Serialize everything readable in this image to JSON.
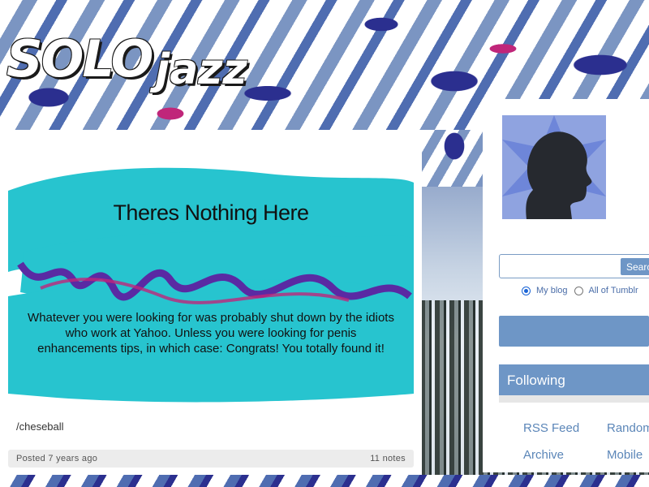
{
  "logo": {
    "part1": "SOLO",
    "part2": "jazz"
  },
  "post": {
    "image_title": "Theres Nothing Here",
    "image_body": "Whatever you were looking for was probably shut down by the idiots who work at Yahoo. Unless you were looking for penis enhancements tips, in which case: Congrats! You totally found it!",
    "caption": "/cheseball",
    "posted": "Posted 7 years ago",
    "notes": "11 notes"
  },
  "sidebar": {
    "avatar_icon": "person-silhouette-icon",
    "search_button": "Search",
    "search_value": "",
    "radio_options": [
      {
        "label": "My blog",
        "checked": true
      },
      {
        "label": "All of Tumblr",
        "checked": false
      }
    ],
    "following_label": "Following",
    "links": {
      "rss": "RSS Feed",
      "random": "Random",
      "archive": "Archive",
      "mobile": "Mobile"
    }
  },
  "colors": {
    "accent": "#6e96c6",
    "link": "#5b86b8",
    "teal": "#27c4cf",
    "purple": "#5a2aa3"
  }
}
